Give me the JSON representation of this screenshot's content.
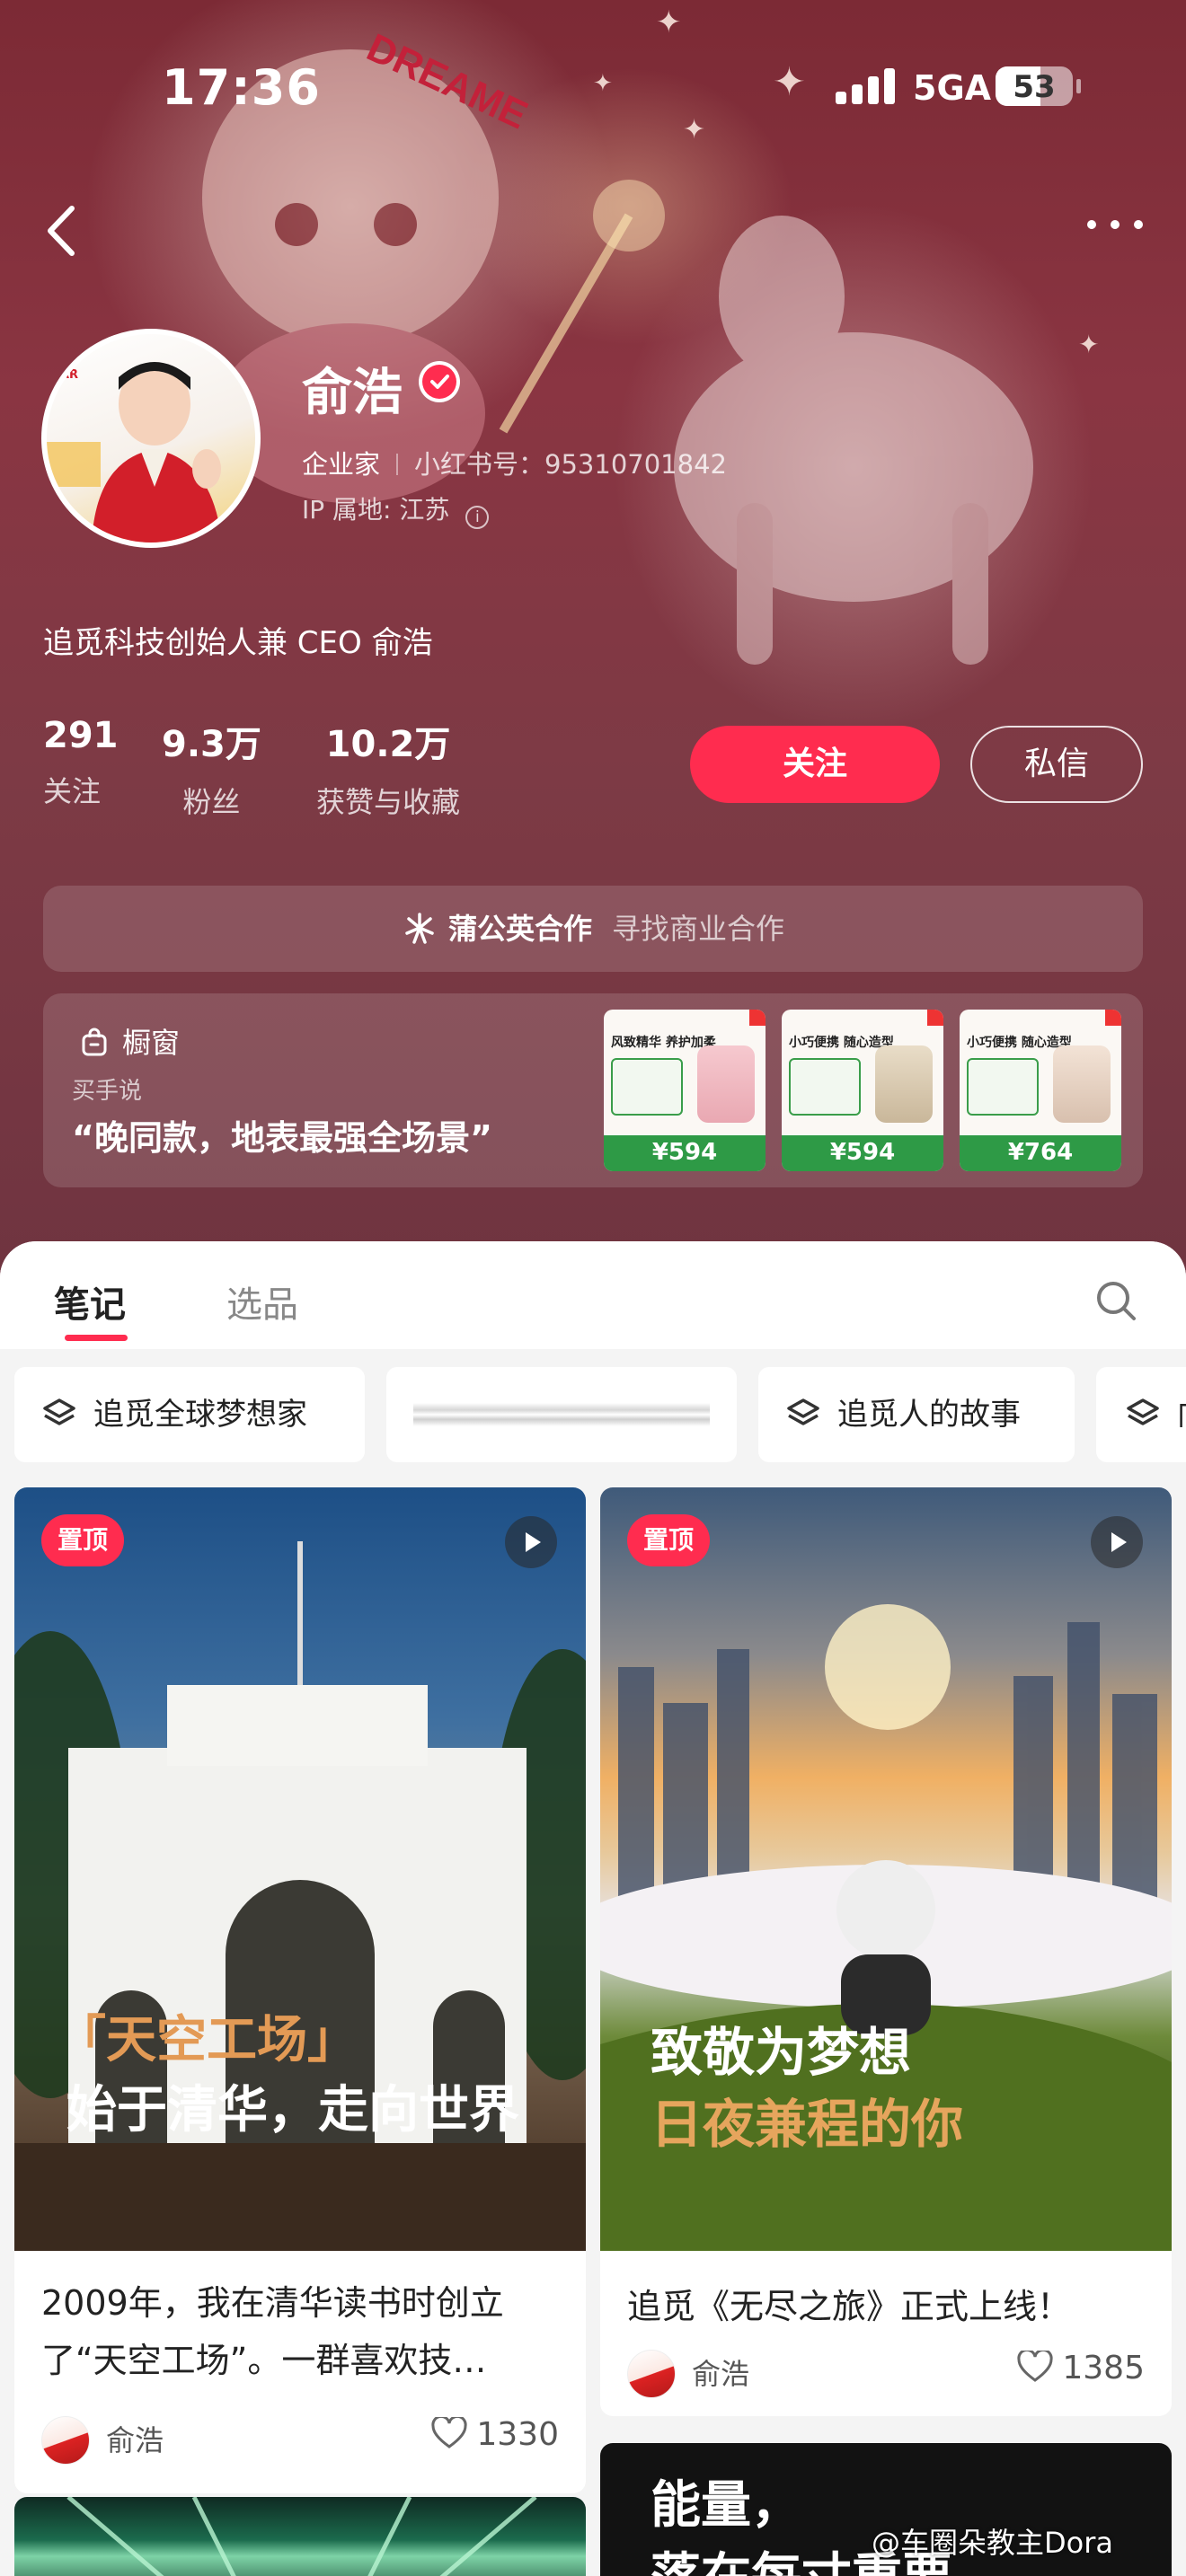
{
  "status_bar": {
    "time": "17:36",
    "network": "5GA",
    "battery": "53"
  },
  "profile": {
    "name": "俞浩",
    "role": "企业家",
    "red_id": "小红书号：95310701842",
    "ip": "IP 属地: 江苏",
    "bio": "追觅科技创始人兼 CEO 俞浩",
    "avatar_badge": "EAR",
    "stats": [
      {
        "value": "291",
        "label": "关注"
      },
      {
        "value": "9.3万",
        "label": "粉丝"
      },
      {
        "value": "10.2万",
        "label": "获赞与收藏"
      }
    ],
    "follow_label": "关注",
    "dm_label": "私信"
  },
  "cooperation": {
    "title": "蒲公英合作",
    "subtitle": "寻找商业合作"
  },
  "showcase": {
    "title": "橱窗",
    "subtitle": "买手说",
    "quote": "“晚同款，地表最强全场景”",
    "products": [
      {
        "title": "风致精华 养护加柔",
        "price": "¥594"
      },
      {
        "title": "小巧便携 随心造型",
        "price": "¥594"
      },
      {
        "title": "小巧便携 随心造型",
        "price": "¥764"
      }
    ]
  },
  "tabs": [
    {
      "label": "笔记"
    },
    {
      "label": "选品"
    }
  ],
  "chips": [
    {
      "label": "追觅全球梦想家"
    },
    {
      "label": ""
    },
    {
      "label": "追觅人的故事"
    },
    {
      "label": "向"
    }
  ],
  "notes": [
    {
      "badge": "置顶",
      "cover_line1": "「天空工场」",
      "cover_line2": "始于清华，走向世界",
      "title": "2009年，我在清华读书时创立了“天空工场”。一群喜欢技…",
      "author": "俞浩",
      "likes": "1330"
    },
    {
      "badge": "置顶",
      "cover_line1": "致敬为梦想",
      "cover_line2": "日夜兼程的你",
      "title": "追觅《无尽之旅》正式上线！",
      "author": "俞浩",
      "likes": "1385"
    },
    {
      "cover_line1": "能量，",
      "cover_line2": "落在每寸重要"
    }
  ],
  "watermark": "@车圈朵教主Dora",
  "colors": {
    "accent": "#ff2c4f",
    "header_bg": "#7c2a35"
  }
}
